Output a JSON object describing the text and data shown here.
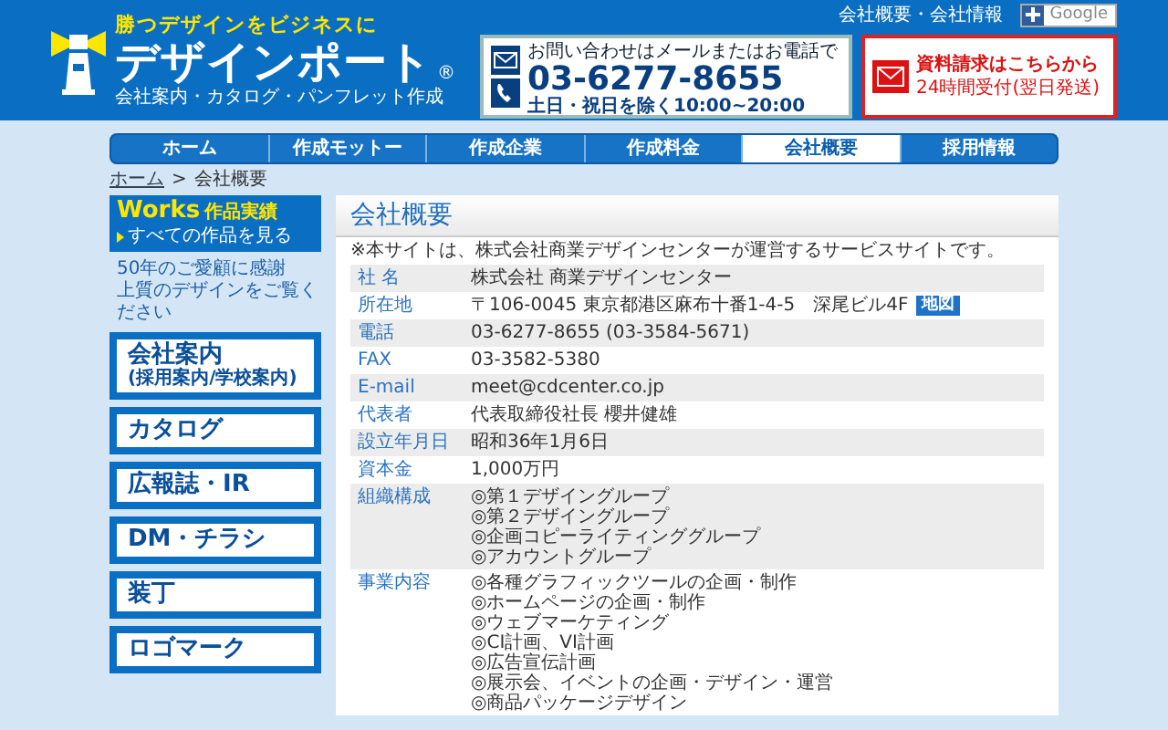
{
  "header": {
    "tagline": "勝つデザインをビジネスに",
    "logo": "デザインポート",
    "logo_mark": "®",
    "subtitle": "会社案内・カタログ・パンフレット作成",
    "top_link": "会社概要・会社情報",
    "google_button": "Google",
    "contact": {
      "note": "お問い合わせはメールまたはお電話で",
      "phone": "03-6277-8655",
      "hours": "土日・祝日を除く10:00~20:00"
    },
    "request": {
      "title": "資料請求はこちらから",
      "sub": "24時間受付(翌日発送)"
    }
  },
  "nav": [
    {
      "label": "ホーム",
      "selected": false
    },
    {
      "label": "作成モットー",
      "selected": false
    },
    {
      "label": "作成企業",
      "selected": false
    },
    {
      "label": "作成料金",
      "selected": false
    },
    {
      "label": "会社概要",
      "selected": true
    },
    {
      "label": "採用情報",
      "selected": false
    }
  ],
  "breadcrumb": [
    {
      "label": "ホーム",
      "kind": "link"
    },
    {
      "label": ">",
      "kind": "separator"
    },
    {
      "label": "会社概要",
      "kind": "current"
    }
  ],
  "sidebar": {
    "works_title": "Works",
    "works_sub": "作品実績",
    "works_link": "すべての作品を見る",
    "intro": [
      "50年のご愛顧に感謝",
      "上質のデザインをご覧ください"
    ],
    "categories": [
      {
        "title": "会社案内",
        "sub": "(採用案内/学校案内)"
      },
      {
        "title": "カタログ"
      },
      {
        "title": "広報誌・IR"
      },
      {
        "title": "DM・チラシ"
      },
      {
        "title": "装丁"
      },
      {
        "title": "ロゴマーク"
      }
    ]
  },
  "content": {
    "title": "会社概要",
    "note": "※本サイトは、株式会社商業デザインセンターが運営するサービスサイトです。",
    "rows": [
      {
        "kind": "text",
        "label": "社 名",
        "value": "株式会社 商業デザインセンター"
      },
      {
        "kind": "address",
        "label": "所在地",
        "value": "〒106-0045 東京都港区麻布十番1-4-5　深尾ビル4F",
        "button": "地図"
      },
      {
        "kind": "text",
        "label": "電話",
        "value": "03-6277-8655 (03-3584-5671)"
      },
      {
        "kind": "text",
        "label": "FAX",
        "value": "03-3582-5380"
      },
      {
        "kind": "text",
        "label": "E-mail",
        "value": "meet@cdcenter.co.jp"
      },
      {
        "kind": "text",
        "label": "代表者",
        "value": "代表取締役社長 櫻井健雄"
      },
      {
        "kind": "text",
        "label": "設立年月日",
        "value": "昭和36年1月6日"
      },
      {
        "kind": "text",
        "label": "資本金",
        "value": "1,000万円"
      },
      {
        "kind": "list",
        "label": "組織構成",
        "items": [
          "◎第１デザイングループ",
          "◎第２デザイングループ",
          "◎企画コピーライティンググループ",
          "◎アカウントグループ"
        ]
      },
      {
        "kind": "list",
        "label": "事業内容",
        "items": [
          "◎各種グラフィックツールの企画・制作",
          "◎ホームページの企画・制作",
          "◎ウェブマーケティング",
          "◎CI計画、VI計画",
          "◎広告宣伝計画",
          "◎展示会、イベントの企画・デザイン・運営",
          "◎商品パッケージデザイン"
        ]
      }
    ]
  }
}
